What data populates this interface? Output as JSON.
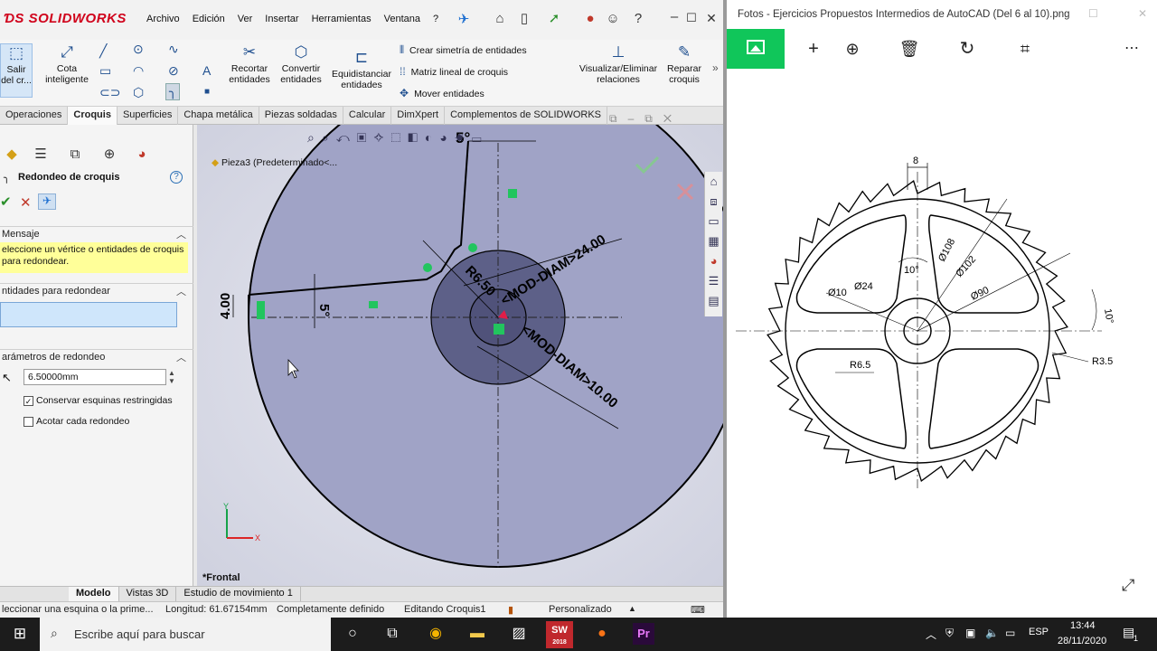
{
  "solidworks": {
    "logo": "SOLIDWORKS",
    "menu": [
      "Archivo",
      "Edición",
      "Ver",
      "Insertar",
      "Herramientas",
      "Ventana",
      "?"
    ],
    "ribbon": {
      "exit_sketch": "Salir del cr...",
      "smart_dim": "Cota inteligente",
      "trim": "Recortar entidades",
      "convert": "Convertir entidades",
      "offset": "Equidistanciar entidades",
      "mirror": "Crear simetría de entidades",
      "linear_pattern": "Matriz lineal de croquis",
      "move": "Mover entidades",
      "display_relations": "Visualizar/Eliminar relaciones",
      "repair": "Reparar croquis"
    },
    "tabs": [
      "Operaciones",
      "Croquis",
      "Superficies",
      "Chapa metálica",
      "Piezas soldadas",
      "Calcular",
      "DimXpert",
      "Complementos de SOLIDWORKS"
    ],
    "active_tab": "Croquis",
    "panel": {
      "title": "Redondeo de croquis",
      "message_header": "Mensaje",
      "message": "eleccione un vértice o entidades de croquis para redondear.",
      "entities_header": "ntidades para redondear",
      "params_header": "arámetros de redondeo",
      "radius_value": "6.50000mm",
      "keep_corners": "Conservar esquinas restringidas",
      "dim_each": "Acotar cada redondeo"
    },
    "graphics": {
      "tree_item": "Pieza3  (Predeterminado<...",
      "view_name": "*Frontal",
      "dim_5_top": "5°",
      "dim_5_left": "5°",
      "dim_400": "4.00",
      "dim_r650": "R6.50",
      "dim_diam24": "<MOD-DIAM>24.00",
      "dim_diam10": "<MOD-DIAM>10.00",
      "axis_x": "X",
      "axis_y": "Y"
    },
    "bottom_tabs": [
      "Modelo",
      "Vistas 3D",
      "Estudio de movimiento 1"
    ],
    "status": {
      "hint": "leccionar una esquina o la prime...",
      "length": "Longitud: 61.67154mm",
      "state": "Completamente definido",
      "editing": "Editando Croquis1",
      "units": "Personalizado"
    }
  },
  "photos": {
    "title": "Fotos - Ejercicios Propuestos Intermedios de AutoCAD (Del 6 al 10).png",
    "drawing": {
      "d8": "8",
      "d108": "Ø108",
      "d102": "Ø102",
      "d90": "Ø90",
      "d24": "Ø24",
      "d10": "Ø10",
      "ang10a": "10°",
      "ang10b": "10°",
      "r65": "R6.5",
      "r35": "R3.5"
    }
  },
  "taskbar": {
    "search_placeholder": "Escribe aquí para buscar",
    "lang": "ESP",
    "time": "13:44",
    "date": "28/11/2020",
    "notif_count": "1",
    "sw_label": "2018"
  }
}
